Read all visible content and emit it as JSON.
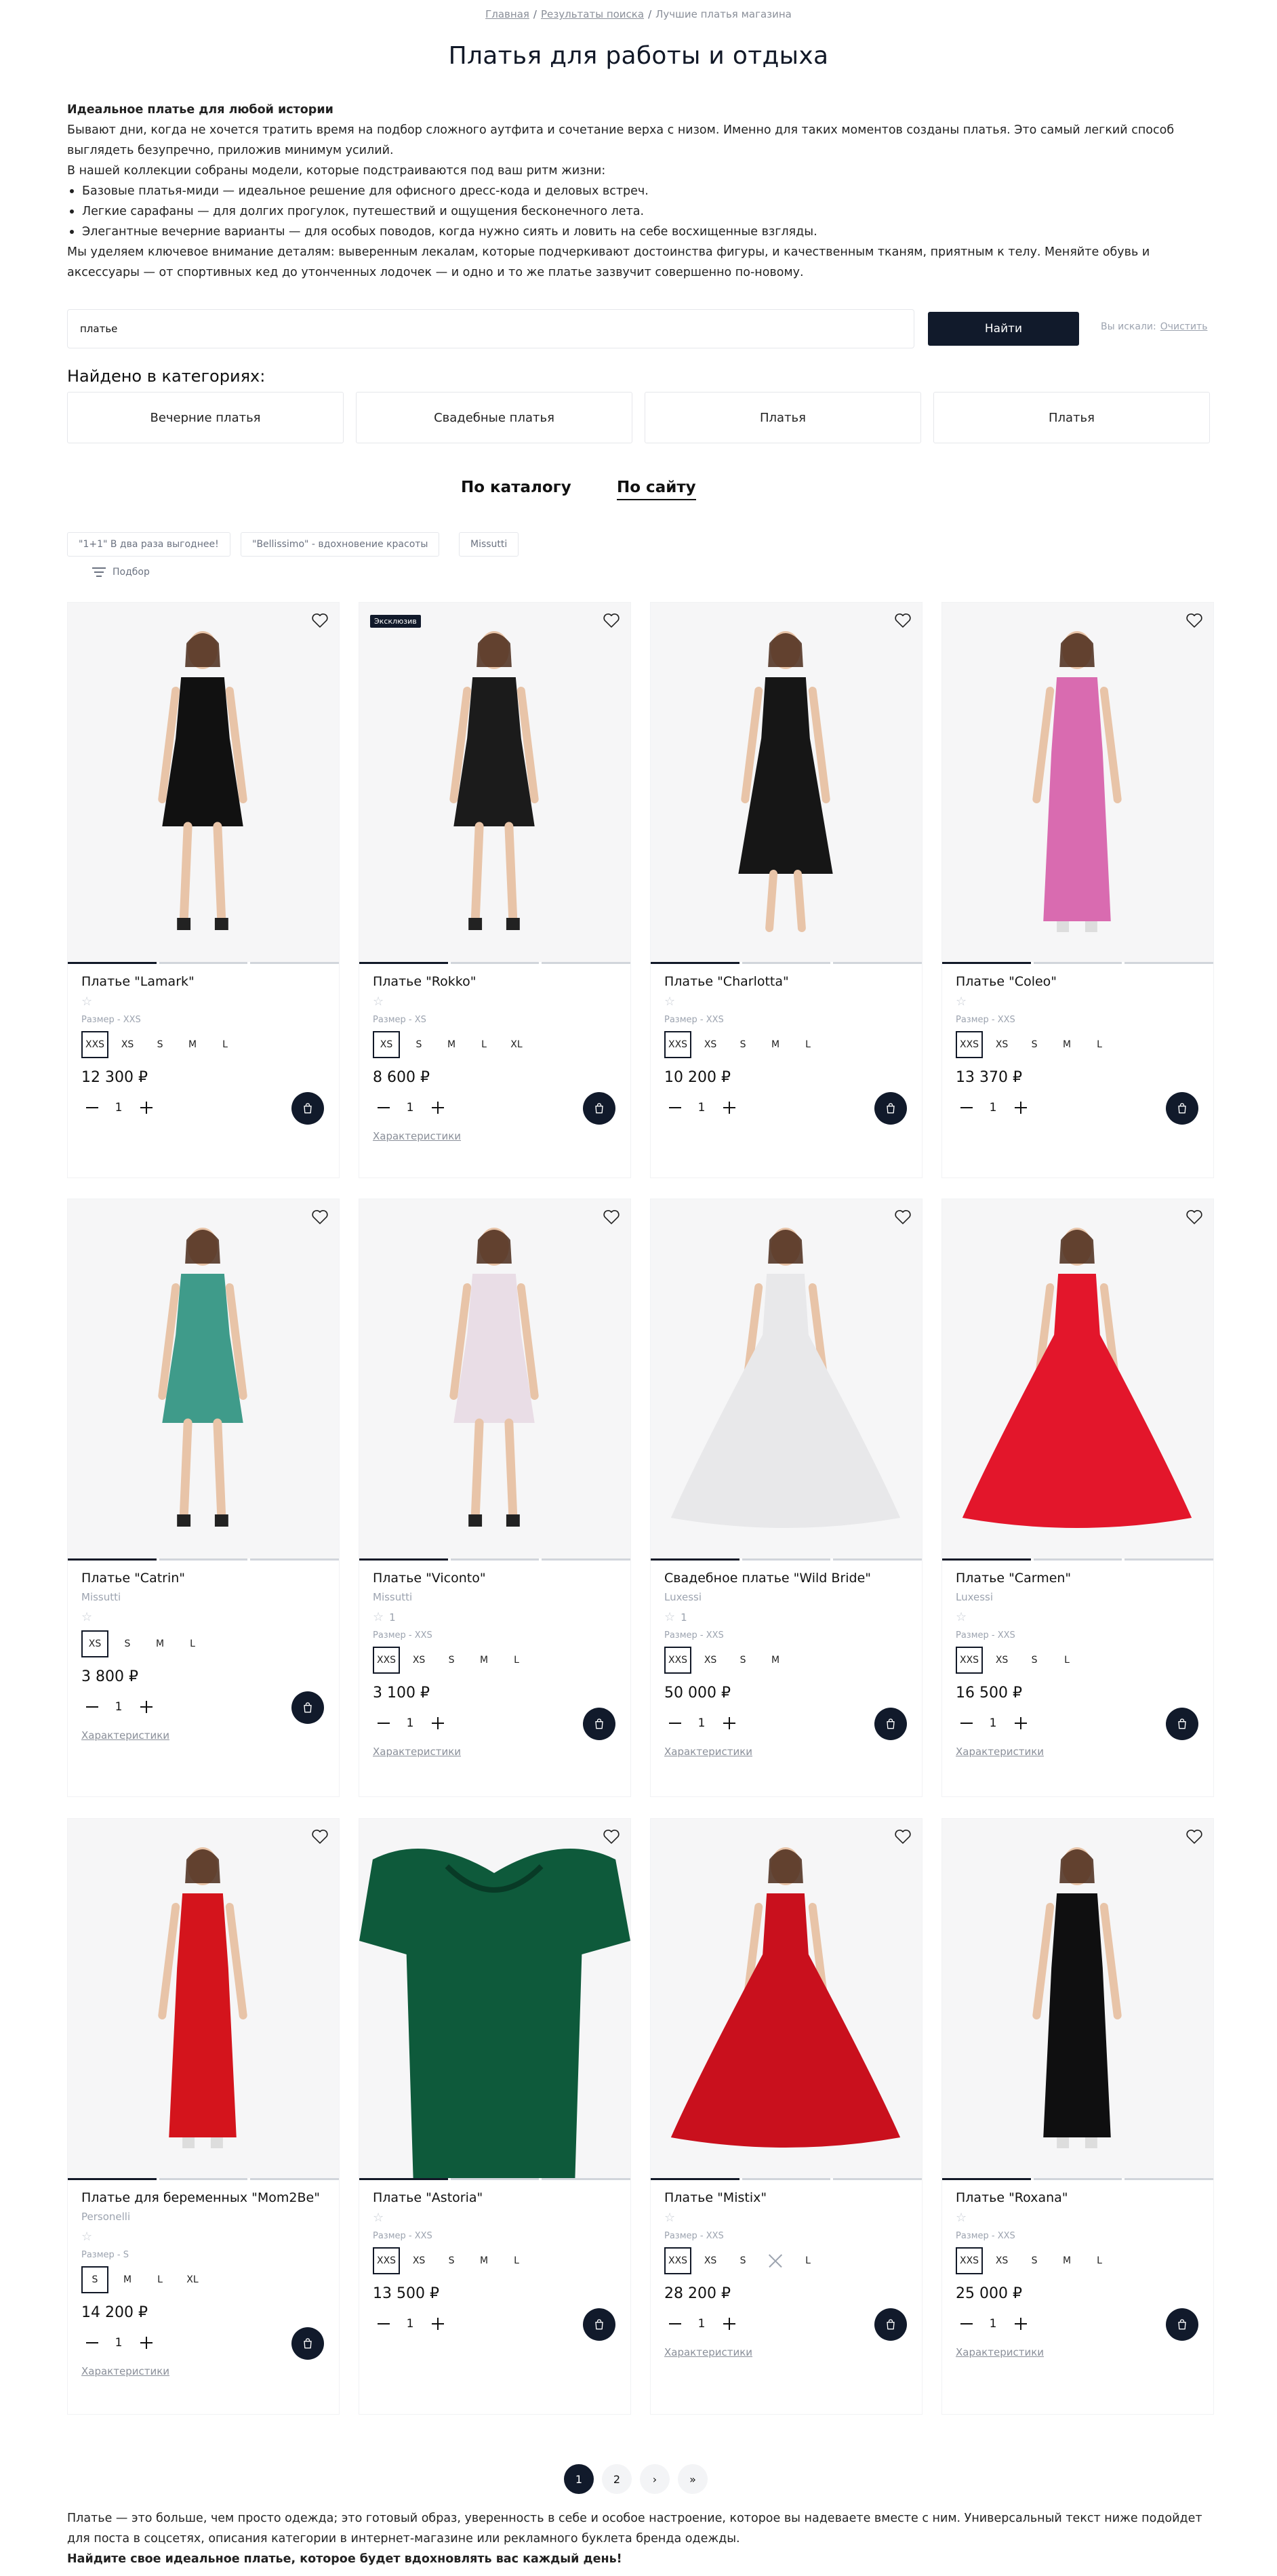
{
  "breadcrumbs": {
    "home": "Главная",
    "search": "Результаты поиска",
    "current": "Лучшие платья магазина",
    "separator": "/"
  },
  "page_title": "Платья для работы и отдыха",
  "intro": {
    "lead": "Идеальное платье для любой истории",
    "p1": "Бывают дни, когда не хочется тратить время на подбор сложного аутфита и сочетание верха с низом. Именно для таких моментов созданы платья. Это самый легкий способ выглядеть безупречно, приложив минимум усилий.",
    "p2": "В нашей коллекции собраны модели, которые подстраиваются под ваш ритм жизни:",
    "list": [
      "Базовые платья-миди — идеальное решение для офисного дресс-кода и деловых встреч.",
      "Легкие сарафаны — для долгих прогулок, путешествий и ощущения бесконечного лета.",
      "Элегантные вечерние варианты — для особых поводов, когда нужно сиять и ловить на себе восхищенные взгляды."
    ],
    "p3": "Мы уделяем ключевое внимание деталям: выверенным лекалам, которые подчеркивают достоинства фигуры, и качественным тканям, приятным к телу. Меняйте обувь и аксессуары — от спортивных кед до утонченных лодочек — и одно и то же платье зазвучит совершенно по-новому."
  },
  "search": {
    "value": "платье",
    "button": "Найти",
    "searched_label": "Вы искали:",
    "clear_label": "Очистить"
  },
  "found_title": "Найдено в категориях:",
  "categories": [
    "Вечерние платья",
    "Свадебные платья",
    "Платья",
    "Платья"
  ],
  "mode_tabs": {
    "catalog": "По каталогу",
    "site": "По сайту"
  },
  "tags": [
    "\"1+1\" В два раза выгоднее!",
    "\"Bellissimo\" - вдохновение красоты",
    "Missutti"
  ],
  "filter_label": "Подбор",
  "badge_exclusive": "Эксклюзив",
  "characteristics_label": "Характеристики",
  "colors": {
    "accent": "#111a2b",
    "muted": "#9ca3af",
    "border": "#e5e7eb"
  },
  "products": [
    {
      "name": "Платье \"Lamark\"",
      "brand": "",
      "rating": "",
      "size_label": "Размер - XXS",
      "sizes": [
        "XXS",
        "XS",
        "S",
        "M",
        "L"
      ],
      "selected": 0,
      "unavailable": [],
      "price": "12 300 ₽",
      "qty": "1",
      "characteristics": false,
      "badge": false,
      "dress": "#111111",
      "style": "short"
    },
    {
      "name": "Платье \"Rokko\"",
      "brand": "",
      "rating": "",
      "size_label": "Размер - XS",
      "sizes": [
        "XS",
        "S",
        "M",
        "L",
        "XL"
      ],
      "selected": 0,
      "unavailable": [],
      "price": "8 600 ₽",
      "qty": "1",
      "characteristics": true,
      "badge": true,
      "dress": "#1b1b1b",
      "style": "short"
    },
    {
      "name": "Платье \"Charlotta\"",
      "brand": "",
      "rating": "",
      "size_label": "Размер - XXS",
      "sizes": [
        "XXS",
        "XS",
        "S",
        "M",
        "L"
      ],
      "selected": 0,
      "unavailable": [],
      "price": "10 200 ₽",
      "qty": "1",
      "characteristics": false,
      "badge": false,
      "dress": "#161616",
      "style": "midi"
    },
    {
      "name": "Платье \"Coleo\"",
      "brand": "",
      "rating": "",
      "size_label": "Размер - XXS",
      "sizes": [
        "XXS",
        "XS",
        "S",
        "M",
        "L"
      ],
      "selected": 0,
      "unavailable": [],
      "price": "13 370 ₽",
      "qty": "1",
      "characteristics": false,
      "badge": false,
      "dress": "#d96bb0",
      "style": "long"
    },
    {
      "name": "Платье \"Catrin\"",
      "brand": "Missutti",
      "rating": "",
      "size_label": "",
      "sizes": [
        "XS",
        "S",
        "M",
        "L"
      ],
      "selected": 0,
      "unavailable": [],
      "price": "3 800 ₽",
      "qty": "1",
      "characteristics": true,
      "badge": false,
      "dress": "#3f9b8a",
      "style": "short"
    },
    {
      "name": "Платье \"Viconto\"",
      "brand": "Missutti",
      "rating": "1",
      "size_label": "Размер - XXS",
      "sizes": [
        "XXS",
        "XS",
        "S",
        "M",
        "L"
      ],
      "selected": 0,
      "unavailable": [],
      "price": "3 100 ₽",
      "qty": "1",
      "characteristics": true,
      "badge": false,
      "dress": "#e9dde6",
      "style": "short"
    },
    {
      "name": "Свадебное платье \"Wild Bride\"",
      "brand": "Luxessi",
      "rating": "1",
      "size_label": "Размер - XXS",
      "sizes": [
        "XXS",
        "XS",
        "S",
        "M"
      ],
      "selected": 0,
      "unavailable": [],
      "price": "50 000 ₽",
      "qty": "1",
      "characteristics": true,
      "badge": false,
      "dress": "#e8e8ea",
      "style": "gown"
    },
    {
      "name": "Платье \"Carmen\"",
      "brand": "Luxessi",
      "rating": "",
      "size_label": "Размер - XXS",
      "sizes": [
        "XXS",
        "XS",
        "S",
        "L"
      ],
      "selected": 0,
      "unavailable": [],
      "price": "16 500 ₽",
      "qty": "1",
      "characteristics": true,
      "badge": false,
      "dress": "#e3162b",
      "style": "gown"
    },
    {
      "name": "Платье для беременных \"Mom2Be\"",
      "brand": "Personelli",
      "rating": "",
      "size_label": "Размер - S",
      "sizes": [
        "S",
        "M",
        "L",
        "XL"
      ],
      "selected": 0,
      "unavailable": [],
      "price": "14 200 ₽",
      "qty": "1",
      "characteristics": true,
      "badge": false,
      "dress": "#d4141c",
      "style": "long"
    },
    {
      "name": "Платье \"Astoria\"",
      "brand": "",
      "rating": "",
      "size_label": "Размер - XXS",
      "sizes": [
        "XXS",
        "XS",
        "S",
        "M",
        "L"
      ],
      "selected": 0,
      "unavailable": [],
      "price": "13 500 ₽",
      "qty": "1",
      "characteristics": false,
      "badge": false,
      "dress": "#0e5a3b",
      "style": "flat"
    },
    {
      "name": "Платье \"Mistix\"",
      "brand": "",
      "rating": "",
      "size_label": "Размер - XXS",
      "sizes": [
        "XXS",
        "XS",
        "S",
        "M",
        "L"
      ],
      "selected": 0,
      "unavailable": [
        3
      ],
      "price": "28 200 ₽",
      "qty": "1",
      "characteristics": true,
      "badge": false,
      "dress": "#c9101d",
      "style": "gown"
    },
    {
      "name": "Платье \"Roxana\"",
      "brand": "",
      "rating": "",
      "size_label": "Размер - XXS",
      "sizes": [
        "XXS",
        "XS",
        "S",
        "M",
        "L"
      ],
      "selected": 0,
      "unavailable": [],
      "price": "25 000 ₽",
      "qty": "1",
      "characteristics": true,
      "badge": false,
      "dress": "#0f0f10",
      "style": "long"
    }
  ],
  "pagination": {
    "pages": [
      "1",
      "2"
    ],
    "active": "1",
    "next": "›",
    "last": "»"
  },
  "footer": {
    "text": "Платье — это больше, чем просто одежда; это готовый образ, уверенность в себе и особое настроение, которое вы надеваете вместе с ним. Универсальный текст ниже подойдет для поста в соцсетях, описания категории в интернет-магазине или рекламного буклета бренда одежды.",
    "strong": "Найдите свое идеальное платье, которое будет вдохновлять вас каждый день!"
  }
}
